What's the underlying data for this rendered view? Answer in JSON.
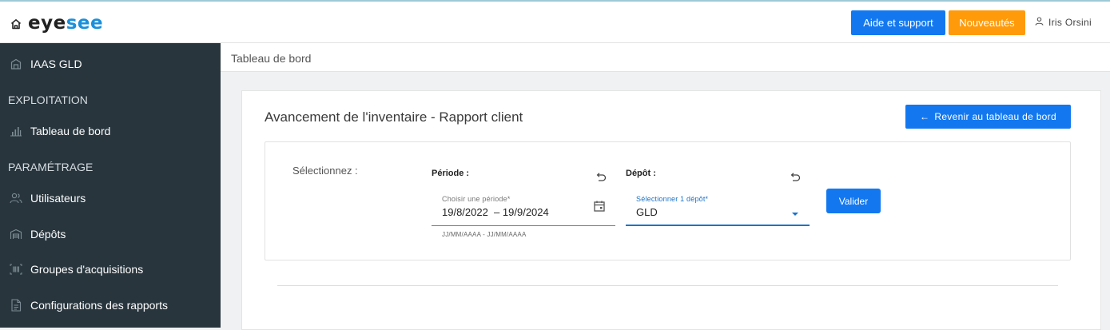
{
  "header": {
    "logo": {
      "part1": "eye",
      "part2": "see",
      "icon": "home-icon"
    },
    "help_label": "Aide et support",
    "news_label": "Nouveautés",
    "user_name": "Iris Orsini",
    "user_icon": "user-icon",
    "colors": {
      "primary": "#1378f0",
      "warning": "#ff9a0a"
    }
  },
  "sidebar": {
    "org": {
      "label": "IAAS GLD",
      "icon": "building-icon"
    },
    "section_exploitation": "EXPLOITATION",
    "dashboard": {
      "label": "Tableau de bord",
      "icon": "bar-chart-icon"
    },
    "section_parametrage": "PARAMÉTRAGE",
    "items": [
      {
        "label": "Utilisateurs",
        "icon": "users-icon"
      },
      {
        "label": "Dépôts",
        "icon": "warehouse-icon"
      },
      {
        "label": "Groupes d'acquisitions",
        "icon": "barcode-icon"
      },
      {
        "label": "Configurations des rapports",
        "icon": "document-icon"
      }
    ],
    "bg_color": "#28353d"
  },
  "breadcrumb": {
    "label": "Tableau de bord"
  },
  "main": {
    "title": "Avancement de l'inventaire - Rapport client",
    "back_button": {
      "arrow": "←",
      "label": "Revenir au tableau de bord"
    },
    "filters": {
      "select_label": "Sélectionnez :",
      "period": {
        "label": "Période :",
        "field_label": "Choisir une période*",
        "value": "19/8/2022  – 19/9/2024",
        "hint": "JJ/MM/AAAA - JJ/MM/AAAA"
      },
      "depot": {
        "label": "Dépôt :",
        "field_label": "Sélectionner 1 dépôt*",
        "value": "GLD"
      },
      "validate_label": "Valider"
    }
  }
}
